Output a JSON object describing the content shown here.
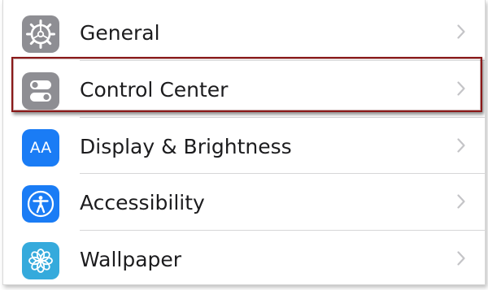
{
  "settings_rows": [
    {
      "label": "General",
      "icon": "gear-icon",
      "icon_color": "#8e8e93"
    },
    {
      "label": "Control Center",
      "icon": "toggle-switches-icon",
      "icon_color": "#8e8e93",
      "highlighted": true
    },
    {
      "label": "Display & Brightness",
      "icon": "text-size-icon",
      "icon_glyph": "AA",
      "icon_color": "#1a7cf5"
    },
    {
      "label": "Accessibility",
      "icon": "accessibility-person-icon",
      "icon_color": "#1a7cf5"
    },
    {
      "label": "Wallpaper",
      "icon": "flower-icon",
      "icon_color": "#35aadc"
    }
  ],
  "highlight_color": "#8b1a1a"
}
